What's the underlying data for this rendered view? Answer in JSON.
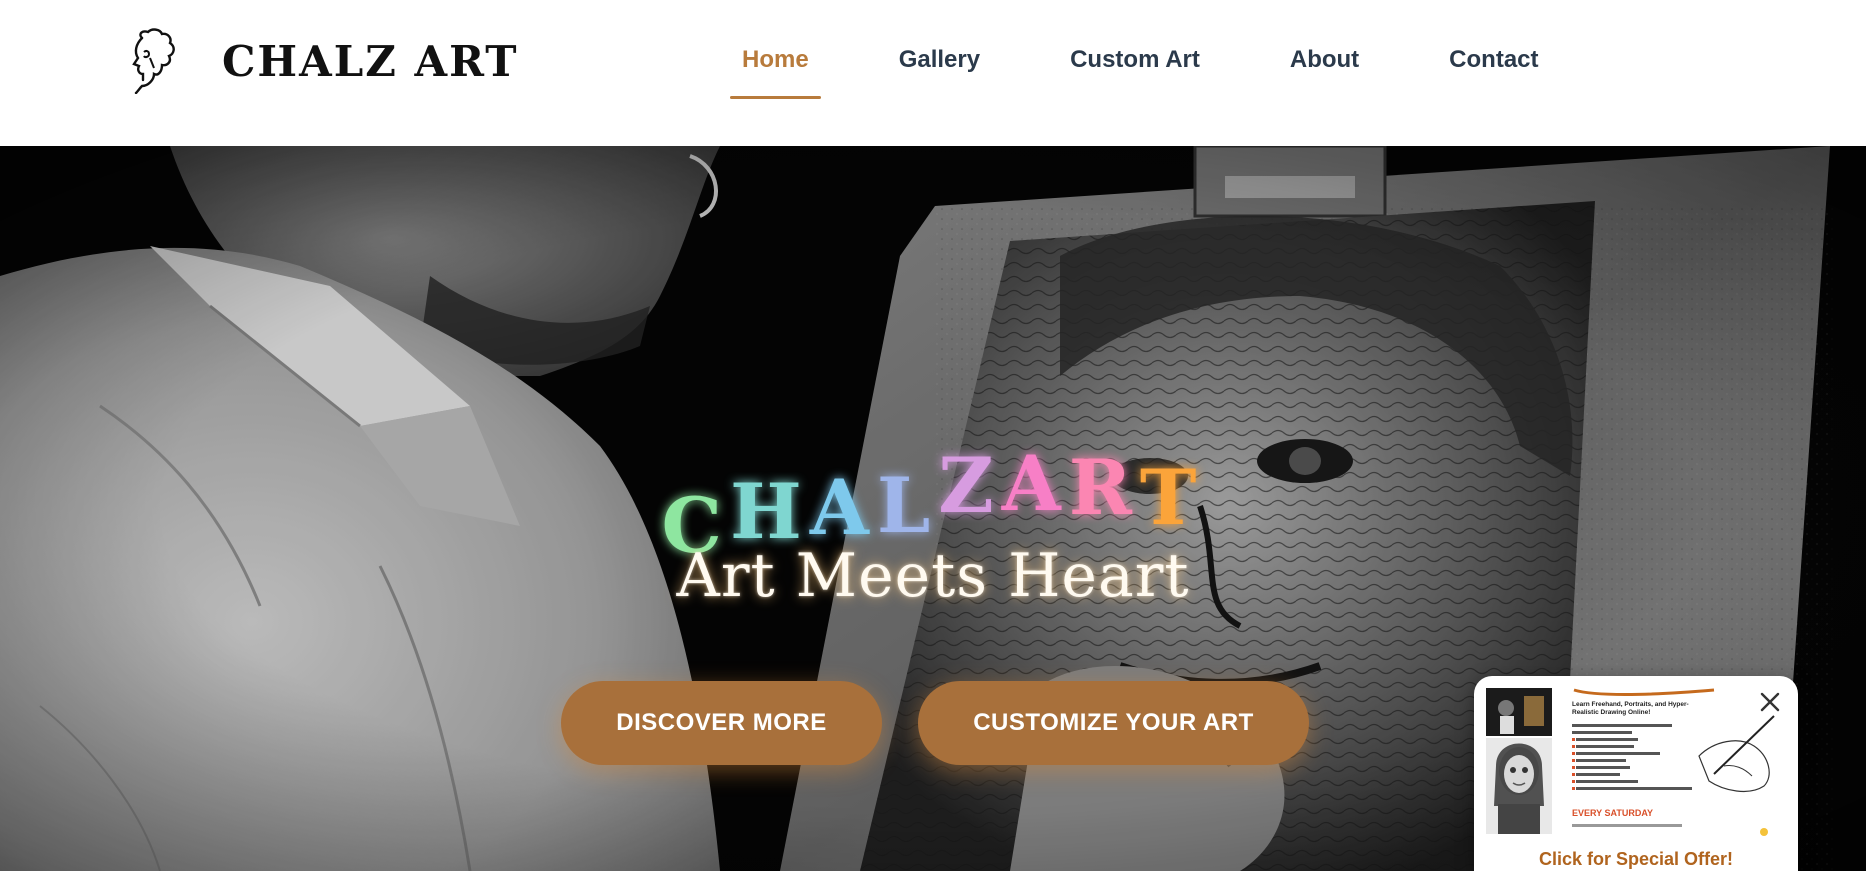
{
  "header": {
    "brand": "CHALZ ART",
    "logo_icon": "artist-face-logo-icon",
    "nav": [
      {
        "label": "Home",
        "active": true
      },
      {
        "label": "Gallery",
        "active": false
      },
      {
        "label": "Custom Art",
        "active": false
      },
      {
        "label": "About",
        "active": false
      },
      {
        "label": "Contact",
        "active": false
      }
    ],
    "accent_color": "#b87b3c",
    "nav_color": "#2b3a4b"
  },
  "hero": {
    "title_letters": [
      {
        "char": "C",
        "color": "#8ee6a0"
      },
      {
        "char": "H",
        "color": "#7fd6d0"
      },
      {
        "char": "A",
        "color": "#7ec9ec"
      },
      {
        "char": "L",
        "color": "#9fb5ea"
      },
      {
        "char": "Z",
        "color": "#d79ce0"
      },
      {
        "char": "A",
        "color": "#f77fc6"
      },
      {
        "char": "R",
        "color": "#fb86b2"
      },
      {
        "char": "T",
        "color": "#fba43a"
      }
    ],
    "tagline": "Art Meets Heart",
    "buttons": {
      "discover": "DISCOVER MORE",
      "customize": "CUSTOMIZE YOUR ART"
    },
    "button_color": "#a8703b"
  },
  "popup": {
    "close_icon": "close-icon",
    "flyer": {
      "intro": "Learn Freehand, Portraits, and Hyper-Realistic Drawing Online!",
      "day": "EVERY SATURDAY"
    },
    "cta": "Click for Special Offer!"
  }
}
